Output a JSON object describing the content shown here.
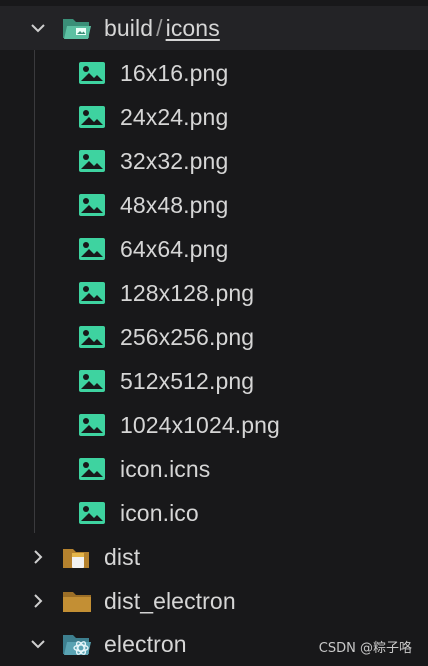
{
  "tree": {
    "open_folder": {
      "name": "build",
      "separator": "/",
      "child": "icons"
    },
    "files": [
      {
        "name": "16x16.png"
      },
      {
        "name": "24x24.png"
      },
      {
        "name": "32x32.png"
      },
      {
        "name": "48x48.png"
      },
      {
        "name": "64x64.png"
      },
      {
        "name": "128x128.png"
      },
      {
        "name": "256x256.png"
      },
      {
        "name": "512x512.png"
      },
      {
        "name": "1024x1024.png"
      },
      {
        "name": "icon.icns"
      },
      {
        "name": "icon.ico"
      }
    ],
    "folders": [
      {
        "name": "dist",
        "icon": "dist-folder-icon"
      },
      {
        "name": "dist_electron",
        "icon": "plain-folder-icon"
      },
      {
        "name": "electron",
        "icon": "electron-folder-icon"
      }
    ]
  },
  "watermark": "CSDN @粽子咯",
  "colors": {
    "background": "#18181a",
    "selected_row": "#232326",
    "image_icon": "#3ed3a0",
    "folder_teal": "#4fa38c",
    "folder_brown": "#b5822e",
    "text": "#d6d6d6"
  },
  "icons": {
    "expanded": "chevron-down-icon",
    "collapsed": "chevron-right-icon",
    "file": "image-file-icon"
  }
}
